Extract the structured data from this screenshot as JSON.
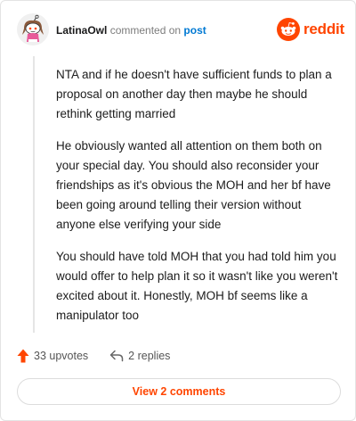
{
  "header": {
    "username": "LatinaOwl",
    "commented_on": "commented on",
    "post_link": "post",
    "brand_name": "reddit"
  },
  "comment": {
    "paragraphs": [
      "NTA and if he doesn't have sufficient funds to plan a proposal on another day then maybe he should rethink getting married",
      "He obviously wanted all attention on them both on your special day. You should also reconsider your friendships as it's obvious the MOH and her bf have been going around telling their version without anyone else verifying your side",
      "You should have told MOH that you had told him you would offer to help plan it so it wasn't like you weren't excited about it. Honestly, MOH bf seems like a manipulator too"
    ]
  },
  "actions": {
    "upvotes": "33 upvotes",
    "replies": "2 replies"
  },
  "view_comments_label": "View 2 comments",
  "colors": {
    "brand": "#ff4500",
    "link": "#0079d3",
    "upvote": "#ff4500",
    "thread_line": "#e5e5e5"
  },
  "icons": {
    "avatar": "snoo-avatar",
    "brand": "reddit-alien-icon",
    "upvote": "upvote-arrow-icon",
    "reply": "reply-arrow-icon"
  }
}
